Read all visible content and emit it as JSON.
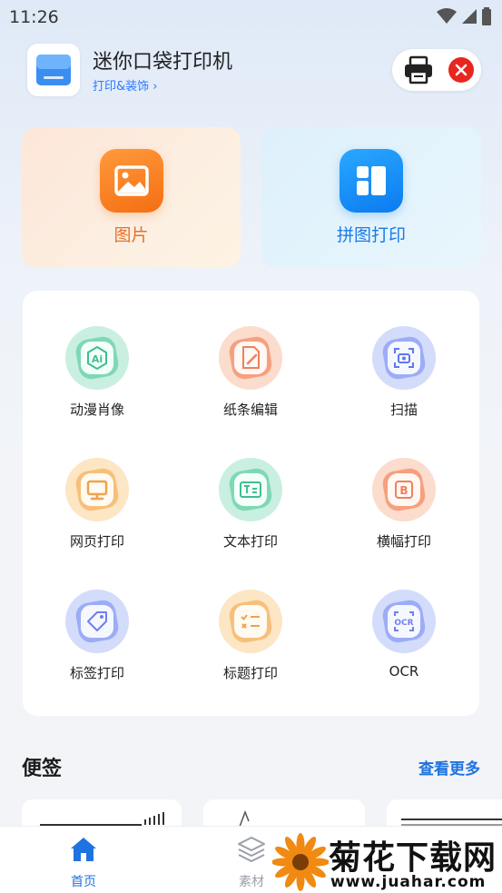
{
  "status_bar": {
    "time": "11:26",
    "icons": [
      "wifi-icon",
      "signal-icon",
      "battery-icon"
    ]
  },
  "header": {
    "title": "迷你口袋打印机",
    "subtitle": "打印&装饰 ›",
    "printer_icon": "printer-icon",
    "status_icon": "close-icon",
    "status_color": "#e8251f"
  },
  "feature_cards": [
    {
      "label": "图片",
      "icon": "image-icon",
      "color": "#f56e12"
    },
    {
      "label": "拼图打印",
      "icon": "collage-icon",
      "color": "#0b7bf0"
    }
  ],
  "tools": [
    {
      "label": "动漫肖像",
      "icon": "ai-portrait-icon",
      "color": "#3fbf8f"
    },
    {
      "label": "纸条编辑",
      "icon": "note-edit-icon",
      "color": "#f0805c"
    },
    {
      "label": "扫描",
      "icon": "scan-icon",
      "color": "#5d78f0"
    },
    {
      "label": "网页打印",
      "icon": "web-print-icon",
      "color": "#f0a24c"
    },
    {
      "label": "文本打印",
      "icon": "text-print-icon",
      "color": "#3fbf8f"
    },
    {
      "label": "横幅打印",
      "icon": "banner-print-icon",
      "color": "#f0805c"
    },
    {
      "label": "标签打印",
      "icon": "tag-icon",
      "color": "#6f7ff0"
    },
    {
      "label": "标题打印",
      "icon": "checklist-icon",
      "color": "#f0a24c"
    },
    {
      "label": "OCR",
      "icon": "ocr-icon",
      "color": "#6f7ff0"
    }
  ],
  "notes": {
    "title": "便签",
    "view_more": "查看更多"
  },
  "bottom_nav": [
    {
      "label": "首页",
      "icon": "home-icon",
      "active": true,
      "color": "#1f73e0"
    },
    {
      "label": "素材",
      "icon": "layers-icon",
      "active": false,
      "color": "#9a9fa8"
    }
  ],
  "watermark": {
    "text": "菊花下载网",
    "url": "www.juahar.com"
  }
}
